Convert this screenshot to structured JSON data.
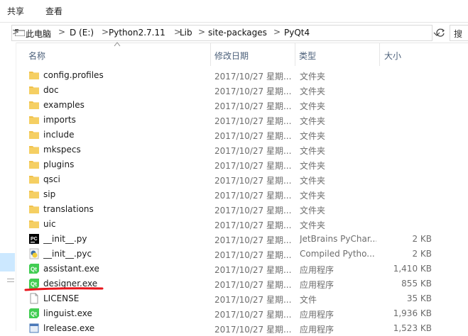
{
  "ribbon": {
    "tabs": [
      "共享",
      "查看"
    ]
  },
  "address": {
    "crumbs": [
      "此电脑",
      "D (E:)",
      "Python2.7.11",
      "Lib",
      "site-packages",
      "PyQt4"
    ],
    "separator": ">",
    "search_text": "搜"
  },
  "columns": {
    "name": "名称",
    "date": "修改日期",
    "type": "类型",
    "size": "大小"
  },
  "files": [
    {
      "name": "config.profiles",
      "date": "2017/10/27 星期...",
      "type": "文件夹",
      "size": "",
      "icon": "folder"
    },
    {
      "name": "doc",
      "date": "2017/10/27 星期...",
      "type": "文件夹",
      "size": "",
      "icon": "folder"
    },
    {
      "name": "examples",
      "date": "2017/10/27 星期...",
      "type": "文件夹",
      "size": "",
      "icon": "folder"
    },
    {
      "name": "imports",
      "date": "2017/10/27 星期...",
      "type": "文件夹",
      "size": "",
      "icon": "folder"
    },
    {
      "name": "include",
      "date": "2017/10/27 星期...",
      "type": "文件夹",
      "size": "",
      "icon": "folder"
    },
    {
      "name": "mkspecs",
      "date": "2017/10/27 星期...",
      "type": "文件夹",
      "size": "",
      "icon": "folder"
    },
    {
      "name": "plugins",
      "date": "2017/10/27 星期...",
      "type": "文件夹",
      "size": "",
      "icon": "folder"
    },
    {
      "name": "qsci",
      "date": "2017/10/27 星期...",
      "type": "文件夹",
      "size": "",
      "icon": "folder"
    },
    {
      "name": "sip",
      "date": "2017/10/27 星期...",
      "type": "文件夹",
      "size": "",
      "icon": "folder"
    },
    {
      "name": "translations",
      "date": "2017/10/27 星期...",
      "type": "文件夹",
      "size": "",
      "icon": "folder"
    },
    {
      "name": "uic",
      "date": "2017/10/27 星期...",
      "type": "文件夹",
      "size": "",
      "icon": "folder"
    },
    {
      "name": "__init__.py",
      "date": "2017/10/27 星期...",
      "type": "JetBrains PyChar...",
      "size": "2 KB",
      "icon": "pycharm"
    },
    {
      "name": "__init__.pyc",
      "date": "2017/10/27 星期...",
      "type": "Compiled Pytho...",
      "size": "2 KB",
      "icon": "python"
    },
    {
      "name": "assistant.exe",
      "date": "2017/10/27 星期...",
      "type": "应用程序",
      "size": "1,410 KB",
      "icon": "qt"
    },
    {
      "name": "designer.exe",
      "date": "2017/10/27 星期...",
      "type": "应用程序",
      "size": "855 KB",
      "icon": "qt"
    },
    {
      "name": "LICENSE",
      "date": "2017/10/27 星期...",
      "type": "文件",
      "size": "35 KB",
      "icon": "file"
    },
    {
      "name": "linguist.exe",
      "date": "2017/10/27 星期...",
      "type": "应用程序",
      "size": "1,936 KB",
      "icon": "qt"
    },
    {
      "name": "lrelease.exe",
      "date": "2017/10/27 星期...",
      "type": "应用程序",
      "size": "1,523 KB",
      "icon": "lrelease"
    }
  ],
  "colors": {
    "folder": "#f0c14b",
    "header_text": "#4c607a",
    "annotation": "#e8141b",
    "qt_green": "#41cd52"
  }
}
